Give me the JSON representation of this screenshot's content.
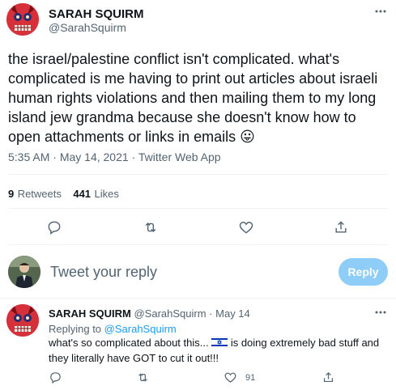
{
  "main_tweet": {
    "display_name": "SARAH SQUIRM",
    "handle": "@SarahSquirm",
    "text": "the israel/palestine conflict isn't complicated. what's complicated is me having to print out articles about israeli human rights violations and then mailing them to my long island jew grandma because she doesn't know how to open attachments or links in emails",
    "emoji": "😛",
    "time": "5:35 AM",
    "date": "May 14, 2021",
    "source": "Twitter Web App",
    "retweets_count": "9",
    "retweets_label": "Retweets",
    "likes_count": "441",
    "likes_label": "Likes"
  },
  "reply_box": {
    "placeholder": "Tweet your reply",
    "button_label": "Reply"
  },
  "reply_tweet": {
    "display_name": "SARAH SQUIRM",
    "handle": "@SarahSquirm",
    "separator": "·",
    "date": "May 14",
    "replying_to_label": "Replying to",
    "replying_to_handle": "@SarahSquirm",
    "text_before_flag": "what's so complicated about this... ",
    "flag_icon": "israel-flag-icon",
    "text_after_flag": " is doing extremely bad stuff and they literally have GOT to cut it out!!!",
    "like_count": "91"
  },
  "colors": {
    "accent": "#1d9bf0",
    "reply_button_disabled": "#8ecdf8",
    "secondary_text": "#536471",
    "divider": "#eff3f4"
  },
  "icons": [
    "more-icon",
    "reply-icon",
    "retweet-icon",
    "like-icon",
    "share-icon"
  ]
}
